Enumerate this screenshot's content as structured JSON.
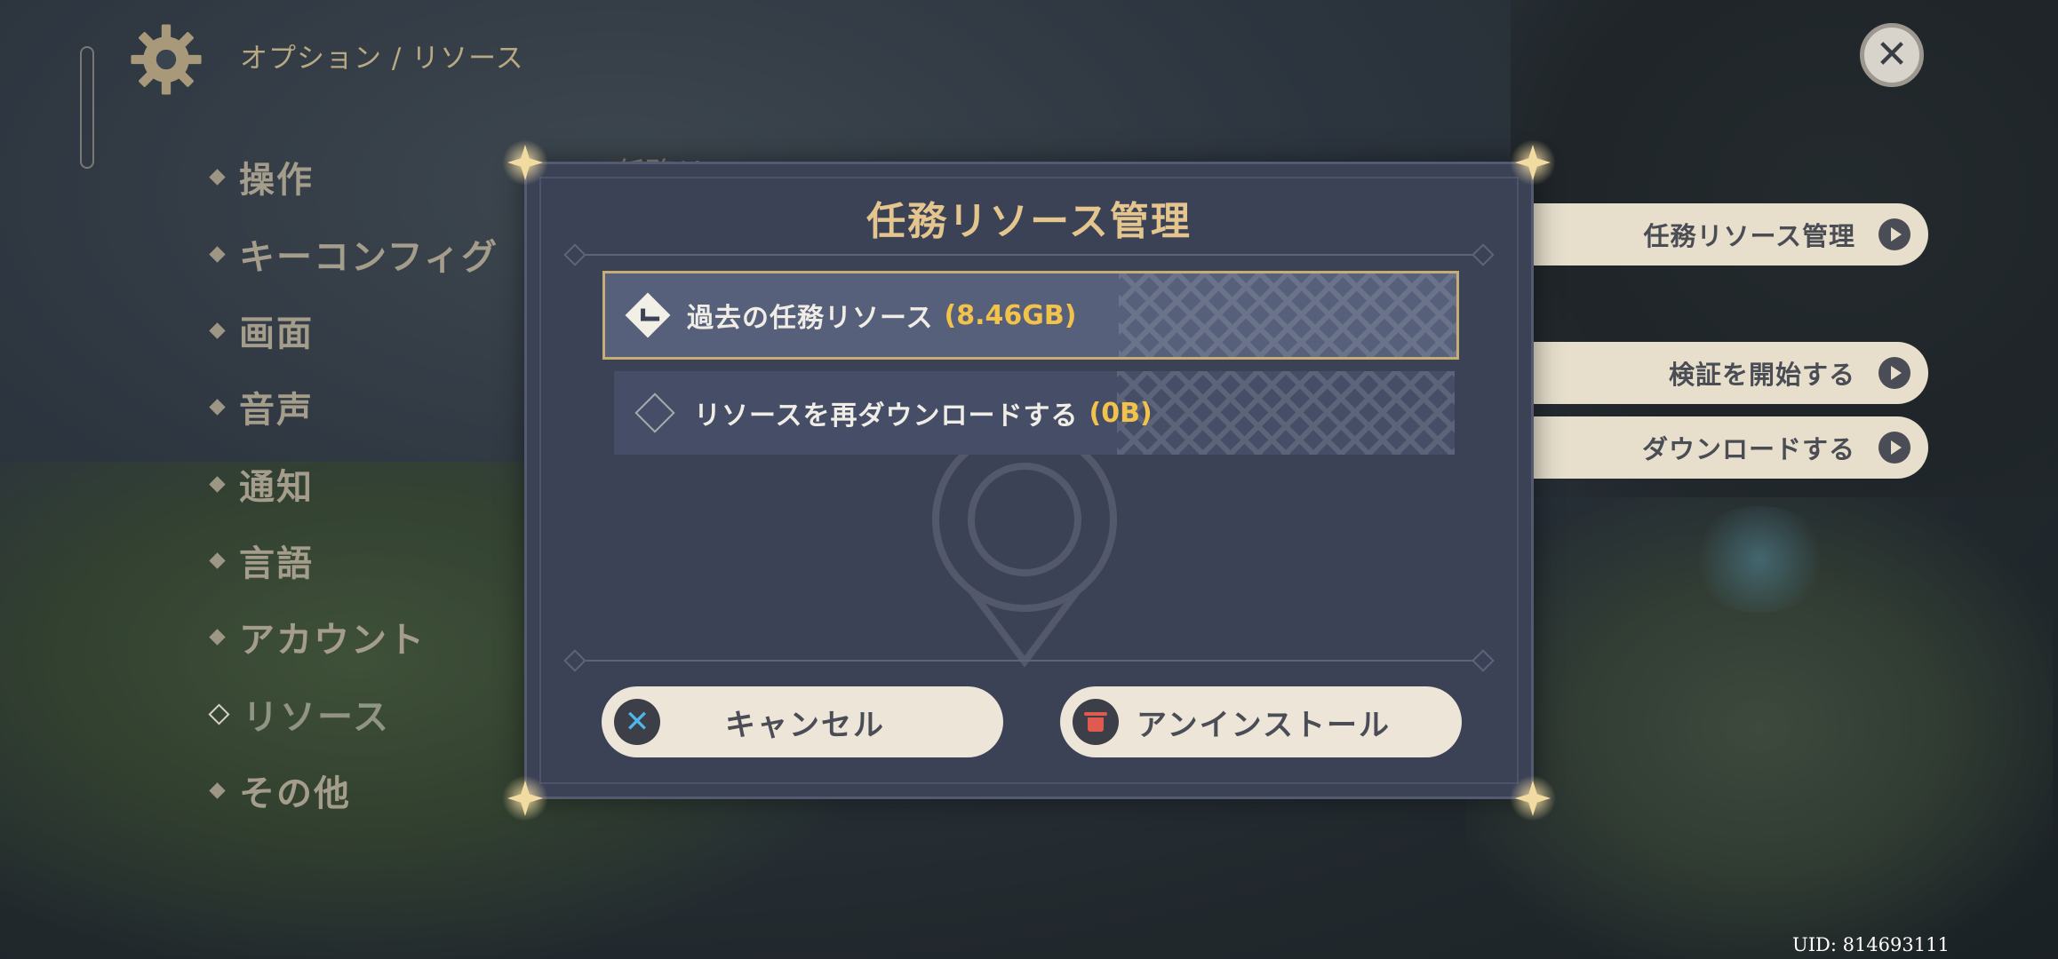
{
  "header": {
    "breadcrumb": "オプション / リソース",
    "icons": {
      "settings": "gear-icon",
      "close": "close-icon"
    }
  },
  "sidebar": {
    "items": [
      {
        "label": "操作"
      },
      {
        "label": "キーコンフィグ"
      },
      {
        "label": "画面"
      },
      {
        "label": "音声"
      },
      {
        "label": "通知"
      },
      {
        "label": "言語"
      },
      {
        "label": "アカウント"
      },
      {
        "label": "リソース",
        "active": true
      },
      {
        "label": "その他"
      }
    ]
  },
  "background_panel": {
    "section_label": "任務リソース",
    "buttons": [
      {
        "label": "任務リソース管理"
      },
      {
        "label": "検証を開始する"
      },
      {
        "label": "ダウンロードする"
      }
    ]
  },
  "dialog": {
    "title": "任務リソース管理",
    "options": [
      {
        "name": "過去の任務リソース",
        "size": "(8.46GB)",
        "checked": true
      },
      {
        "name": "リソースを再ダウンロードする",
        "size": "(0B)",
        "checked": false
      }
    ],
    "cancel_label": "キャンセル",
    "uninstall_label": "アンインストール"
  },
  "footer": {
    "uid": "UID: 814693111"
  },
  "colors": {
    "accent_gold": "#e4c58e",
    "size_yellow": "#f2c24a",
    "dialog_bg": "#3b4256",
    "button_cream": "#ede6d8",
    "cancel_icon_blue": "#4fb6ec",
    "trash_icon_red": "#e05a4f"
  }
}
